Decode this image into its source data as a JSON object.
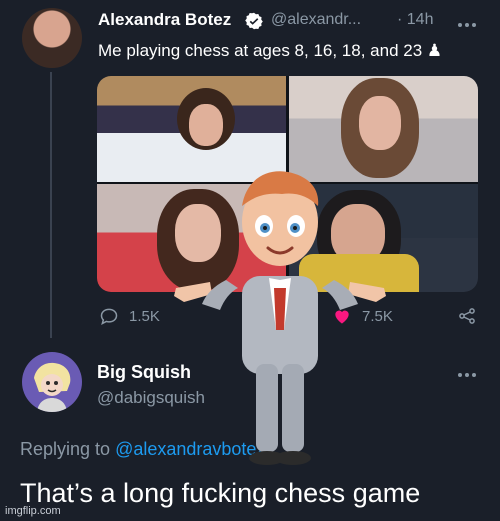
{
  "tweet": {
    "author_name": "Alexandra Botez",
    "handle": "@alexandr...",
    "time": "· 14h",
    "text": "Me playing chess at ages 8, 16, 18, and 23 ♟",
    "actions": {
      "replies": "1.5K",
      "likes": "7.5K"
    }
  },
  "reply": {
    "author_name": "Big Squish",
    "handle": "@dabigsquish",
    "replying_prefix": "Replying to",
    "replying_handle": "@alexandravbotez",
    "text": "That’s a long fucking chess game"
  },
  "watermark": "imgflip.com",
  "colors": {
    "background": "#1a1f29",
    "link": "#1d9bf0",
    "verified": "#1d9bf0",
    "muted": "#8b98a5"
  },
  "icons": [
    "verified-icon",
    "more-icon",
    "reply-icon",
    "like-icon",
    "share-icon",
    "meme-character"
  ]
}
